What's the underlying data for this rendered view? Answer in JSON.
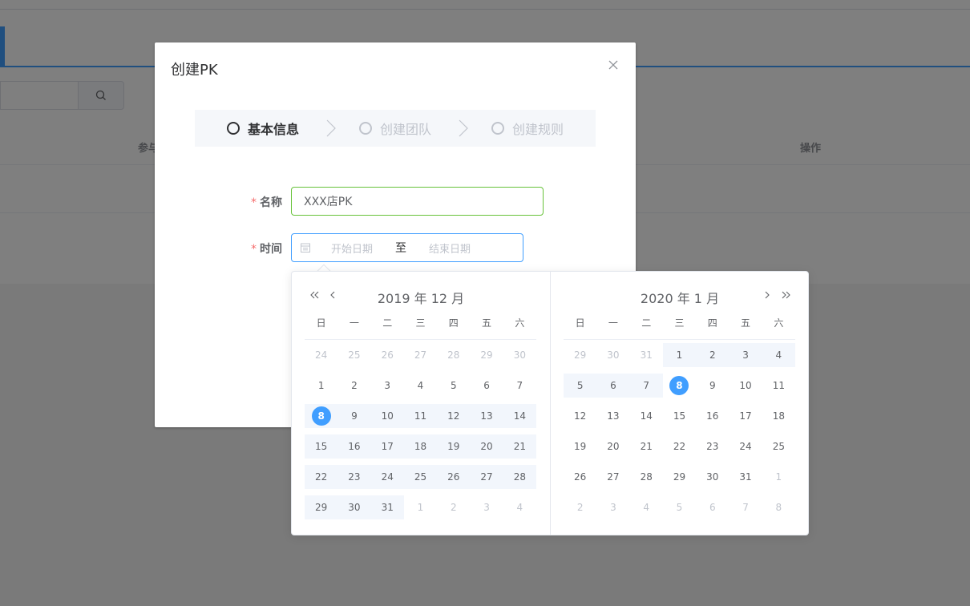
{
  "background": {
    "table_headers": [
      "参与",
      "操作"
    ]
  },
  "dialog": {
    "title": "创建PK",
    "steps": [
      {
        "label": "基本信息",
        "state": "active"
      },
      {
        "label": "创建团队",
        "state": "wait"
      },
      {
        "label": "创建规则",
        "state": "wait"
      }
    ],
    "form": {
      "name_label": "名称",
      "name_value": "XXX店PK",
      "time_label": "时间",
      "required_mark": "*",
      "start_placeholder": "开始日期",
      "range_separator": "至",
      "end_placeholder": "结束日期"
    }
  },
  "picker": {
    "weekdays": [
      "日",
      "一",
      "二",
      "三",
      "四",
      "五",
      "六"
    ],
    "left": {
      "header": "2019 年 12 月",
      "weeks": [
        [
          {
            "d": "24",
            "o": 1
          },
          {
            "d": "25",
            "o": 1
          },
          {
            "d": "26",
            "o": 1
          },
          {
            "d": "27",
            "o": 1
          },
          {
            "d": "28",
            "o": 1
          },
          {
            "d": "29",
            "o": 1
          },
          {
            "d": "30",
            "o": 1
          }
        ],
        [
          {
            "d": "1"
          },
          {
            "d": "2"
          },
          {
            "d": "3"
          },
          {
            "d": "4"
          },
          {
            "d": "5"
          },
          {
            "d": "6"
          },
          {
            "d": "7"
          }
        ],
        [
          {
            "d": "8",
            "t": 1,
            "r": 1
          },
          {
            "d": "9",
            "r": 1
          },
          {
            "d": "10",
            "r": 1
          },
          {
            "d": "11",
            "r": 1
          },
          {
            "d": "12",
            "r": 1
          },
          {
            "d": "13",
            "r": 1
          },
          {
            "d": "14",
            "r": 1
          }
        ],
        [
          {
            "d": "15",
            "r": 1
          },
          {
            "d": "16",
            "r": 1
          },
          {
            "d": "17",
            "r": 1
          },
          {
            "d": "18",
            "r": 1
          },
          {
            "d": "19",
            "r": 1
          },
          {
            "d": "20",
            "r": 1
          },
          {
            "d": "21",
            "r": 1
          }
        ],
        [
          {
            "d": "22",
            "r": 1
          },
          {
            "d": "23",
            "r": 1
          },
          {
            "d": "24",
            "r": 1
          },
          {
            "d": "25",
            "r": 1
          },
          {
            "d": "26",
            "r": 1
          },
          {
            "d": "27",
            "r": 1
          },
          {
            "d": "28",
            "r": 1
          }
        ],
        [
          {
            "d": "29",
            "r": 1
          },
          {
            "d": "30",
            "r": 1
          },
          {
            "d": "31",
            "r": 1
          },
          {
            "d": "1",
            "o": 1
          },
          {
            "d": "2",
            "o": 1
          },
          {
            "d": "3",
            "o": 1
          },
          {
            "d": "4",
            "o": 1
          }
        ]
      ]
    },
    "right": {
      "header": "2020 年 1 月",
      "weeks": [
        [
          {
            "d": "29",
            "o": 1
          },
          {
            "d": "30",
            "o": 1
          },
          {
            "d": "31",
            "o": 1
          },
          {
            "d": "1",
            "r": 1
          },
          {
            "d": "2",
            "r": 1
          },
          {
            "d": "3",
            "r": 1
          },
          {
            "d": "4",
            "r": 1
          }
        ],
        [
          {
            "d": "5",
            "r": 1
          },
          {
            "d": "6",
            "r": 1
          },
          {
            "d": "7",
            "r": 1
          },
          {
            "d": "8",
            "t": 1
          },
          {
            "d": "9"
          },
          {
            "d": "10"
          },
          {
            "d": "11"
          }
        ],
        [
          {
            "d": "12"
          },
          {
            "d": "13"
          },
          {
            "d": "14"
          },
          {
            "d": "15"
          },
          {
            "d": "16"
          },
          {
            "d": "17"
          },
          {
            "d": "18"
          }
        ],
        [
          {
            "d": "19"
          },
          {
            "d": "20"
          },
          {
            "d": "21"
          },
          {
            "d": "22"
          },
          {
            "d": "23"
          },
          {
            "d": "24"
          },
          {
            "d": "25"
          }
        ],
        [
          {
            "d": "26"
          },
          {
            "d": "27"
          },
          {
            "d": "28"
          },
          {
            "d": "29"
          },
          {
            "d": "30"
          },
          {
            "d": "31"
          },
          {
            "d": "1",
            "o": 1
          }
        ],
        [
          {
            "d": "2",
            "o": 1
          },
          {
            "d": "3",
            "o": 1
          },
          {
            "d": "4",
            "o": 1
          },
          {
            "d": "5",
            "o": 1
          },
          {
            "d": "6",
            "o": 1
          },
          {
            "d": "7",
            "o": 1
          },
          {
            "d": "8",
            "o": 1
          }
        ]
      ]
    }
  },
  "colors": {
    "accent": "#409eff",
    "success_border": "#67c23a",
    "required": "#f56c6c",
    "range_bg": "#f2f6fc"
  }
}
